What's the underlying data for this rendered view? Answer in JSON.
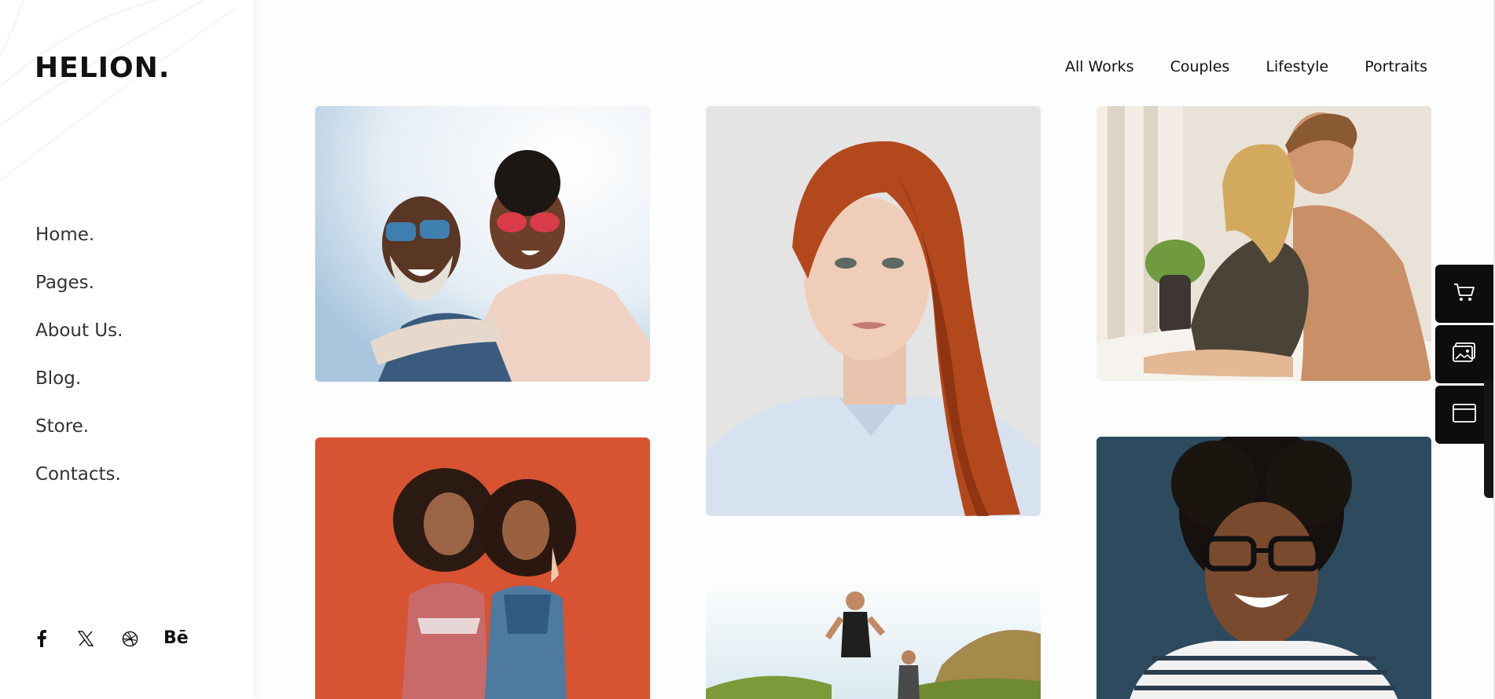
{
  "brand": {
    "logo_text": "HELION."
  },
  "nav": {
    "items": [
      {
        "label": "Home."
      },
      {
        "label": "Pages."
      },
      {
        "label": "About Us."
      },
      {
        "label": "Blog."
      },
      {
        "label": "Store."
      },
      {
        "label": "Contacts."
      }
    ]
  },
  "social": {
    "icons": [
      "facebook-icon",
      "x-twitter-icon",
      "dribbble-icon",
      "behance-icon"
    ],
    "behance_label": "Bē"
  },
  "filters": {
    "items": [
      {
        "label": "All Works"
      },
      {
        "label": "Couples"
      },
      {
        "label": "Lifestyle"
      },
      {
        "label": "Portraits"
      }
    ]
  },
  "gallery": {
    "items": [
      {
        "subject": "smiling-couple-sunglasses-photo"
      },
      {
        "subject": "red-haired-woman-portrait-photo"
      },
      {
        "subject": "couple-in-bed-photo"
      },
      {
        "subject": "two-women-orange-wall-photo"
      },
      {
        "subject": "runners-outdoors-photo"
      },
      {
        "subject": "woman-glasses-portrait-photo"
      }
    ]
  },
  "toolbar": {
    "icons": [
      "cart-icon",
      "image-gallery-icon",
      "browser-window-icon"
    ]
  },
  "colors": {
    "accent_dark": "#0d0d0d",
    "sidebar_bg": "#ffffff",
    "page_bg": "#fdfdfd",
    "nav_text": "#333333"
  }
}
